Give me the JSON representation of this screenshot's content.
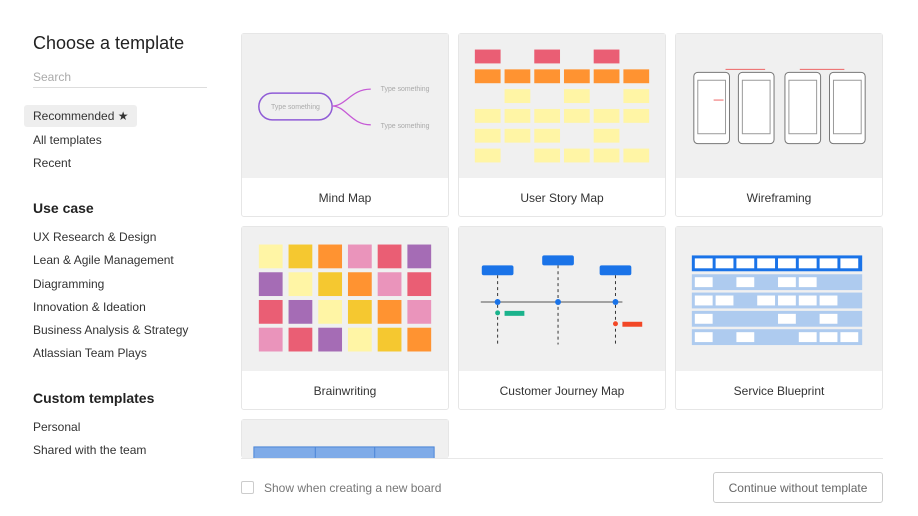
{
  "sidebar": {
    "title": "Choose a template",
    "search_placeholder": "Search",
    "nav": [
      {
        "label": "Recommended ★"
      },
      {
        "label": "All templates"
      },
      {
        "label": "Recent"
      }
    ],
    "use_case": {
      "header": "Use case",
      "items": [
        "UX Research & Design",
        "Lean & Agile Management",
        "Diagramming",
        "Innovation & Ideation",
        "Business Analysis & Strategy",
        "Atlassian Team Plays"
      ]
    },
    "custom": {
      "header": "Custom templates",
      "items": [
        "Personal",
        "Shared with the team"
      ]
    }
  },
  "templates": [
    {
      "label": "Mind Map",
      "preview_text": [
        "Type something",
        "Type something",
        "Type something"
      ]
    },
    {
      "label": "User Story Map"
    },
    {
      "label": "Wireframing"
    },
    {
      "label": "Brainwriting"
    },
    {
      "label": "Customer Journey Map"
    },
    {
      "label": "Service Blueprint"
    },
    {
      "label": ""
    }
  ],
  "footer": {
    "checkbox_label": "Show when creating a new board",
    "checked": false,
    "continue_label": "Continue without template"
  },
  "colors": {
    "mind_map_node": "#8f5bd6",
    "blue": "#1a73e8",
    "yellow": "#fff5a5",
    "orange": "#ff9331",
    "red": "#ea5e74"
  }
}
